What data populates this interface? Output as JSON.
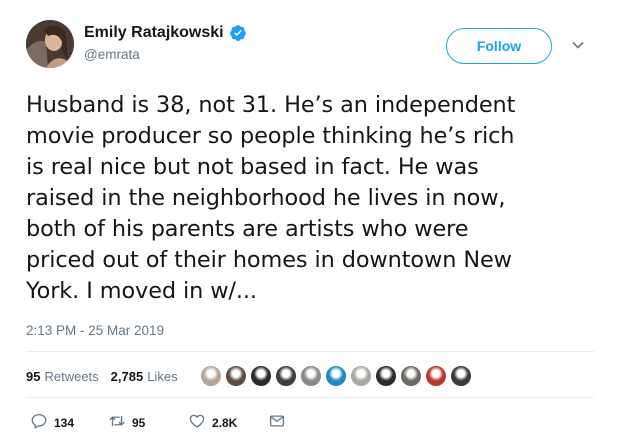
{
  "author": {
    "display_name": "Emily Ratajkowski",
    "handle": "@emrata",
    "verified_icon": "verified-badge-icon",
    "accent": "#1da1f2"
  },
  "header": {
    "follow_label": "Follow",
    "menu_icon": "chevron-down-icon"
  },
  "tweet": {
    "lines": [
      "Husband is 38, not 31. He’s an independent",
      "movie producer so people thinking he’s rich",
      "is real nice but not based in fact. He was",
      "raised in the neighborhood he lives in now,",
      "both of his parents are artists who were",
      "priced out of their homes in downtown New",
      "York. I moved in w/..."
    ],
    "timestamp": "2:13 PM - 25 Mar 2019"
  },
  "stats": {
    "retweets_count": "95",
    "retweets_label": "Retweets",
    "likes_count": "2,785",
    "likes_label": "Likes",
    "liker_avatars": [
      "#b7a597",
      "#5f4b40",
      "#2b2b2b",
      "#3e3e3e",
      "#8a8a8a",
      "#1f8bb8",
      "#a9aaa5",
      "#2c2c2c",
      "#6d6a64",
      "#b63a2f",
      "#3a3a3a"
    ]
  },
  "actions": {
    "reply_count": "134",
    "retweet_count": "95",
    "like_count": "2.8K",
    "icons": [
      "reply-icon",
      "retweet-icon",
      "like-icon",
      "message-icon"
    ]
  }
}
